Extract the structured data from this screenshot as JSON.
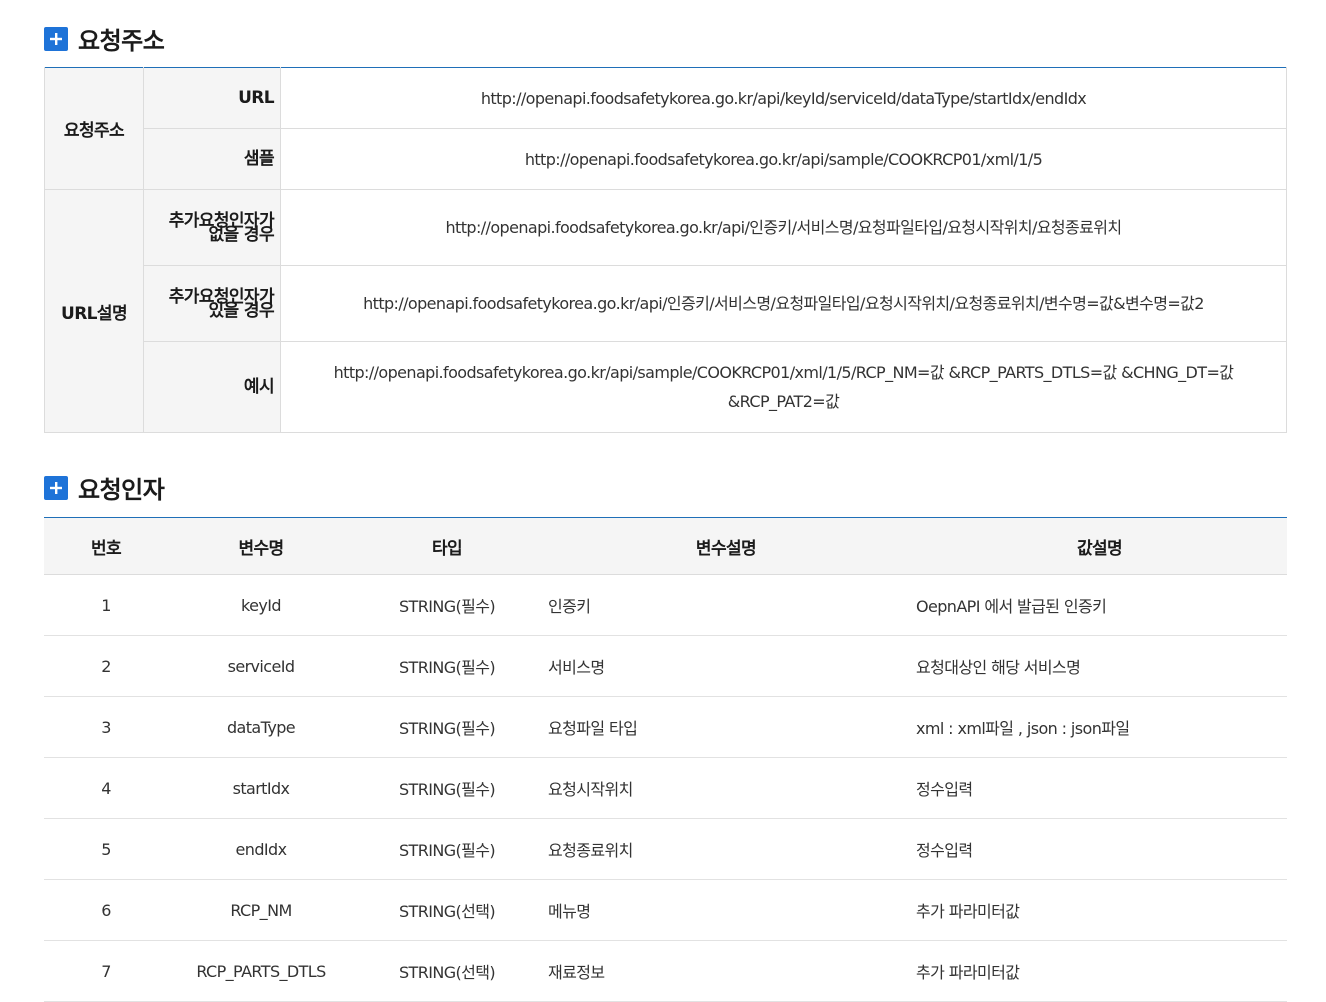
{
  "sections": {
    "request_url": {
      "title": "요청주소"
    },
    "request_params": {
      "title": "요청인자"
    }
  },
  "url_table": {
    "group1_label": "요청주소",
    "group2_label": "URL설명",
    "rows": [
      {
        "label": "URL",
        "value": "http://openapi.foodsafetykorea.go.kr/api/keyId/serviceId/dataType/startIdx/endIdx"
      },
      {
        "label": "샘플",
        "value": "http://openapi.foodsafetykorea.go.kr/api/sample/COOKRCP01/xml/1/5"
      },
      {
        "label_line1": "추가요청인자가",
        "label_line2": "없을 경우",
        "value": "http://openapi.foodsafetykorea.go.kr/api/인증키/서비스명/요청파일타입/요청시작위치/요청종료위치"
      },
      {
        "label_line1": "추가요청인자가",
        "label_line2": "있을 경우",
        "value": "http://openapi.foodsafetykorea.go.kr/api/인증키/서비스명/요청파일타입/요청시작위치/요청종료위치/변수명=값&변수명=값2"
      },
      {
        "label": "예시",
        "value": "http://openapi.foodsafetykorea.go.kr/api/sample/COOKRCP01/xml/1/5/RCP_NM=값 &RCP_PARTS_DTLS=값 &CHNG_DT=값 &RCP_PAT2=값"
      }
    ]
  },
  "param_table": {
    "headers": [
      "번호",
      "변수명",
      "타입",
      "변수설명",
      "값설명"
    ],
    "rows": [
      [
        "1",
        "keyId",
        "STRING(필수)",
        "인증키",
        "OepnAPI 에서 발급된 인증키"
      ],
      [
        "2",
        "serviceId",
        "STRING(필수)",
        "서비스명",
        "요청대상인 해당 서비스명"
      ],
      [
        "3",
        "dataType",
        "STRING(필수)",
        "요청파일 타입",
        "xml : xml파일 , json : json파일"
      ],
      [
        "4",
        "startIdx",
        "STRING(필수)",
        "요청시작위치",
        "정수입력"
      ],
      [
        "5",
        "endIdx",
        "STRING(필수)",
        "요청종료위치",
        "정수입력"
      ],
      [
        "6",
        "RCP_NM",
        "STRING(선택)",
        "메뉴명",
        "추가 파라미터값"
      ],
      [
        "7",
        "RCP_PARTS_DTLS",
        "STRING(선택)",
        "재료정보",
        "추가 파라미터값"
      ]
    ]
  },
  "colors": {
    "accent": "#1e73d8",
    "header_rule": "#1f6fb8",
    "label_bg": "#f5f5f5"
  }
}
